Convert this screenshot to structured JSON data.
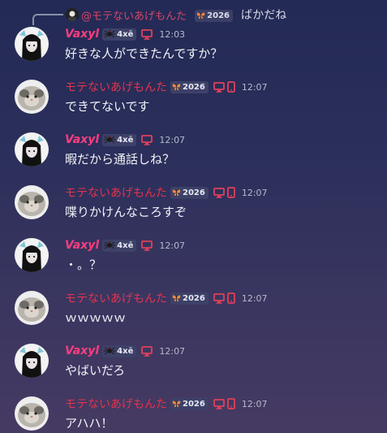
{
  "reply": {
    "name": "@モテないあげもんた",
    "tag": "2026",
    "text": "ばかだね"
  },
  "colors": {
    "vaxyl_name": "#ff3d7f",
    "mote_name": "#e3344e",
    "device_icon": "#e0405a"
  },
  "messages": [
    {
      "author": "Vaxyl",
      "tag": "4xē",
      "time": "12:03",
      "text": "好きな人ができたんですか？"
    },
    {
      "author": "モテないあげもんた",
      "tag": "2026",
      "time": "12:07",
      "text": "できてないです"
    },
    {
      "author": "Vaxyl",
      "tag": "4xē",
      "time": "12:07",
      "text": "暇だから通話しね？"
    },
    {
      "author": "モテないあげもんた",
      "tag": "2026",
      "time": "12:07",
      "text": "喋りかけんなころすぞ"
    },
    {
      "author": "Vaxyl",
      "tag": "4xē",
      "time": "12:07",
      "text": "・。？"
    },
    {
      "author": "モテないあげもんた",
      "tag": "2026",
      "time": "12:07",
      "text": "ｗｗｗｗｗ"
    },
    {
      "author": "Vaxyl",
      "tag": "4xē",
      "time": "12:07",
      "text": "やばいだろ"
    },
    {
      "author": "モテないあげもんた",
      "tag": "2026",
      "time": "12:07",
      "text": "アハハ！"
    }
  ]
}
